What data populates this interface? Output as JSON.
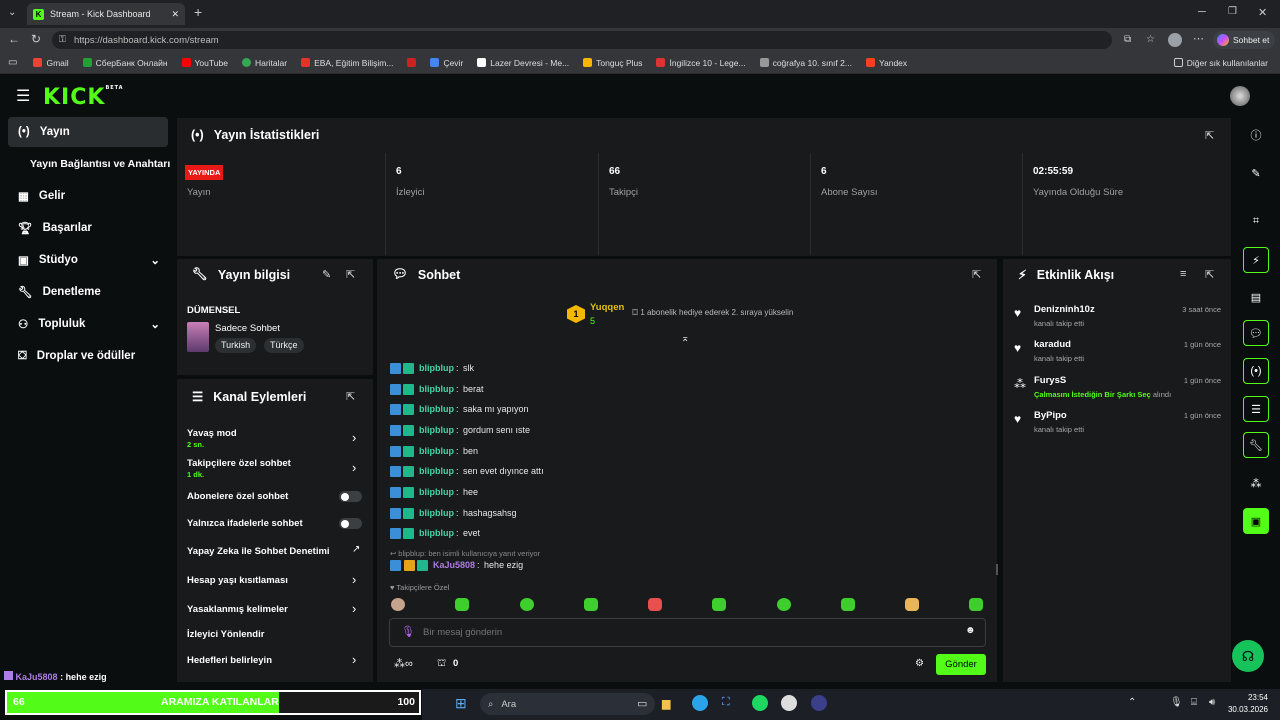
{
  "browser": {
    "tab_title": "Stream - Kick Dashboard",
    "url": "https://dashboard.kick.com/stream",
    "chat_button": "Sohbet et",
    "bookmarks": [
      "Gmail",
      "СберБанк Онлайн",
      "YouTube",
      "Haritalar",
      "EBA, Eğitim Bilişim...",
      "Çevir",
      "Lazer Devresi - Me...",
      "Tonguç Plus",
      "İngilizce 10 - Lege...",
      "coğrafya 10. sınıf 2...",
      "Yandex"
    ],
    "other_bookmarks": "Diğer sık kullanılanlar"
  },
  "app": {
    "logo": "KICK",
    "logo_badge": "BETA"
  },
  "sidebar": {
    "items": [
      {
        "label": "Yayın",
        "icon": "broadcast-icon"
      },
      {
        "label": "Yayın Bağlantısı ve Anahtarı",
        "icon": ""
      },
      {
        "label": "Gelir",
        "icon": "grid-icon"
      },
      {
        "label": "Başarılar",
        "icon": "trophy-icon"
      },
      {
        "label": "Stüdyo",
        "icon": "studio-icon"
      },
      {
        "label": "Denetleme",
        "icon": "wrench-icon"
      },
      {
        "label": "Topluluk",
        "icon": "community-icon"
      },
      {
        "label": "Droplar ve ödüller",
        "icon": "gift-icon"
      }
    ]
  },
  "stats": {
    "title": "Yayın İstatistikleri",
    "live_badge": "YAYINDA",
    "items": [
      {
        "value": "",
        "label": "Yayın"
      },
      {
        "value": "6",
        "label": "İzleyici"
      },
      {
        "value": "66",
        "label": "Takipçi"
      },
      {
        "value": "6",
        "label": "Abone Sayısı"
      },
      {
        "value": "02:55:59",
        "label": "Yayında Olduğu Süre"
      }
    ]
  },
  "stream_info": {
    "title": "Yayın bilgisi",
    "stream_name": "DÜMENSEL",
    "category": "Sadece Sohbet",
    "tags": [
      "Turkish",
      "Türkçe"
    ]
  },
  "channel_actions": {
    "title": "Kanal Eylemleri",
    "items": [
      {
        "label": "Yavaş mod",
        "sub": "2 sn."
      },
      {
        "label": "Takipçilere özel sohbet",
        "sub": "1 dk."
      },
      {
        "label": "Abonelere özel sohbet",
        "sub": ""
      },
      {
        "label": "Yalnızca ifadelerle sohbet",
        "sub": ""
      },
      {
        "label": "Yapay Zeka ile Sohbet Denetimi",
        "sub": ""
      },
      {
        "label": "Hesap yaşı kısıtlaması",
        "sub": ""
      },
      {
        "label": "Yasaklanmış kelimeler",
        "sub": ""
      },
      {
        "label": "İzleyici Yönlendir",
        "sub": ""
      },
      {
        "label": "Hedefleri belirleyin",
        "sub": ""
      }
    ]
  },
  "chat": {
    "title": "Sohbet",
    "top_gifter": "Yuqqen",
    "top_gifter_count": "5",
    "gift_prompt": "1 abonelik hediye ederek 2. sıraya yükselin",
    "messages": [
      {
        "user": "blipblup",
        "text": "slk"
      },
      {
        "user": "blipblup",
        "text": "berat"
      },
      {
        "user": "blipblup",
        "text": "saka mı yapıyon"
      },
      {
        "user": "blipblup",
        "text": "gordum senı ıste"
      },
      {
        "user": "blipblup",
        "text": "ben"
      },
      {
        "user": "blipblup",
        "text": "sen evet dıyınce attı"
      },
      {
        "user": "blipblup",
        "text": "hee"
      },
      {
        "user": "blipblup",
        "text": "hashagsahsg"
      },
      {
        "user": "blipblup",
        "text": "evet"
      }
    ],
    "reply_note": "blipblup: ben isimli kullanıcıya yanıt veriyor",
    "last_user": "KaJu5808",
    "last_text": "hehe ezig",
    "followers_only": "Takipçilere Özel",
    "input_placeholder": "Bir mesaj gönderin",
    "points": "0",
    "send": "Gönder"
  },
  "activity": {
    "title": "Etkinlik Akışı",
    "events": [
      {
        "name": "Denizninh10z",
        "desc": "kanalı takip etti",
        "time": "3 saat önce",
        "icon": "heart-icon"
      },
      {
        "name": "karadud",
        "desc": "kanalı takip etti",
        "time": "1 gün önce",
        "icon": "heart-icon"
      },
      {
        "name": "FurysS",
        "desc_highlight": "Çalmasını İstediğin Bir Şarkı Seç",
        "desc": "alındı",
        "time": "1 gün önce",
        "icon": "points-icon"
      },
      {
        "name": "ByPipo",
        "desc": "kanalı takip etti",
        "time": "1 gün önce",
        "icon": "heart-icon"
      }
    ]
  },
  "overlay": {
    "chat_user": "KaJu5808",
    "chat_text": "hehe ezig",
    "goal_count": "66",
    "goal_label": "ARAMIZA KATILANLAR",
    "goal_target": "100",
    "goal_progress": 0.66
  },
  "taskbar": {
    "search": "Ara",
    "time": "23:54",
    "date": "30.03.2026"
  }
}
